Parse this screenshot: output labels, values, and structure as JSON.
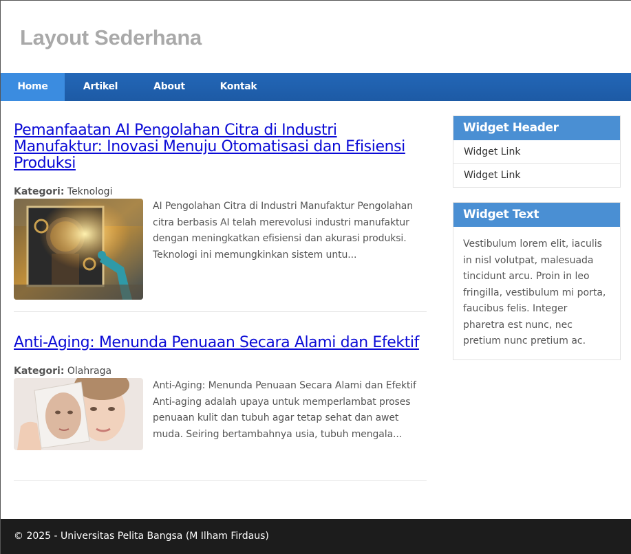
{
  "site": {
    "title": "Layout Sederhana"
  },
  "nav": {
    "items": [
      {
        "label": "Home",
        "active": true
      },
      {
        "label": "Artikel",
        "active": false
      },
      {
        "label": "About",
        "active": false
      },
      {
        "label": "Kontak",
        "active": false
      }
    ]
  },
  "articles": [
    {
      "title": "Pemanfaatan AI Pengolahan Citra di Industri Manufaktur: Inovasi Menuju Otomatisasi dan Efisiensi Produksi",
      "category_label": "Kategori:",
      "category": "Teknologi",
      "excerpt": "AI Pengolahan Citra di Industri Manufaktur Pengolahan citra berbasis AI telah merevolusi industri manufaktur dengan meningkatkan efisiensi dan akurasi produksi. Teknologi ini memungkinkan sistem untu..."
    },
    {
      "title": "Anti-Aging: Menunda Penuaan Secara Alami dan Efektif",
      "category_label": "Kategori:",
      "category": "Olahraga",
      "excerpt": "Anti-Aging: Menunda Penuaan Secara Alami dan Efektif Anti-aging adalah upaya untuk memperlambat proses penuaan kulit dan tubuh agar tetap sehat dan awet muda. Seiring bertambahnya usia, tubuh mengala..."
    }
  ],
  "sidebar": {
    "widget_links": {
      "header": "Widget Header",
      "links": [
        "Widget Link",
        "Widget Link"
      ]
    },
    "widget_text": {
      "header": "Widget Text",
      "body": "Vestibulum lorem elit, iaculis in nisl volutpat, malesuada tincidunt arcu. Proin in leo fringilla, vestibulum mi porta, faucibus felis. Integer pharetra est nunc, nec pretium nunc pretium ac."
    }
  },
  "footer": {
    "text": "© 2025 - Universitas Pelita Bangsa (M Ilham Firdaus)"
  },
  "colors": {
    "nav": "#1d5aa5",
    "nav_active": "#3b8ce0",
    "widget_header": "#4a8fd3",
    "link": "#0b0bd6",
    "footer": "#1c1c1c"
  }
}
